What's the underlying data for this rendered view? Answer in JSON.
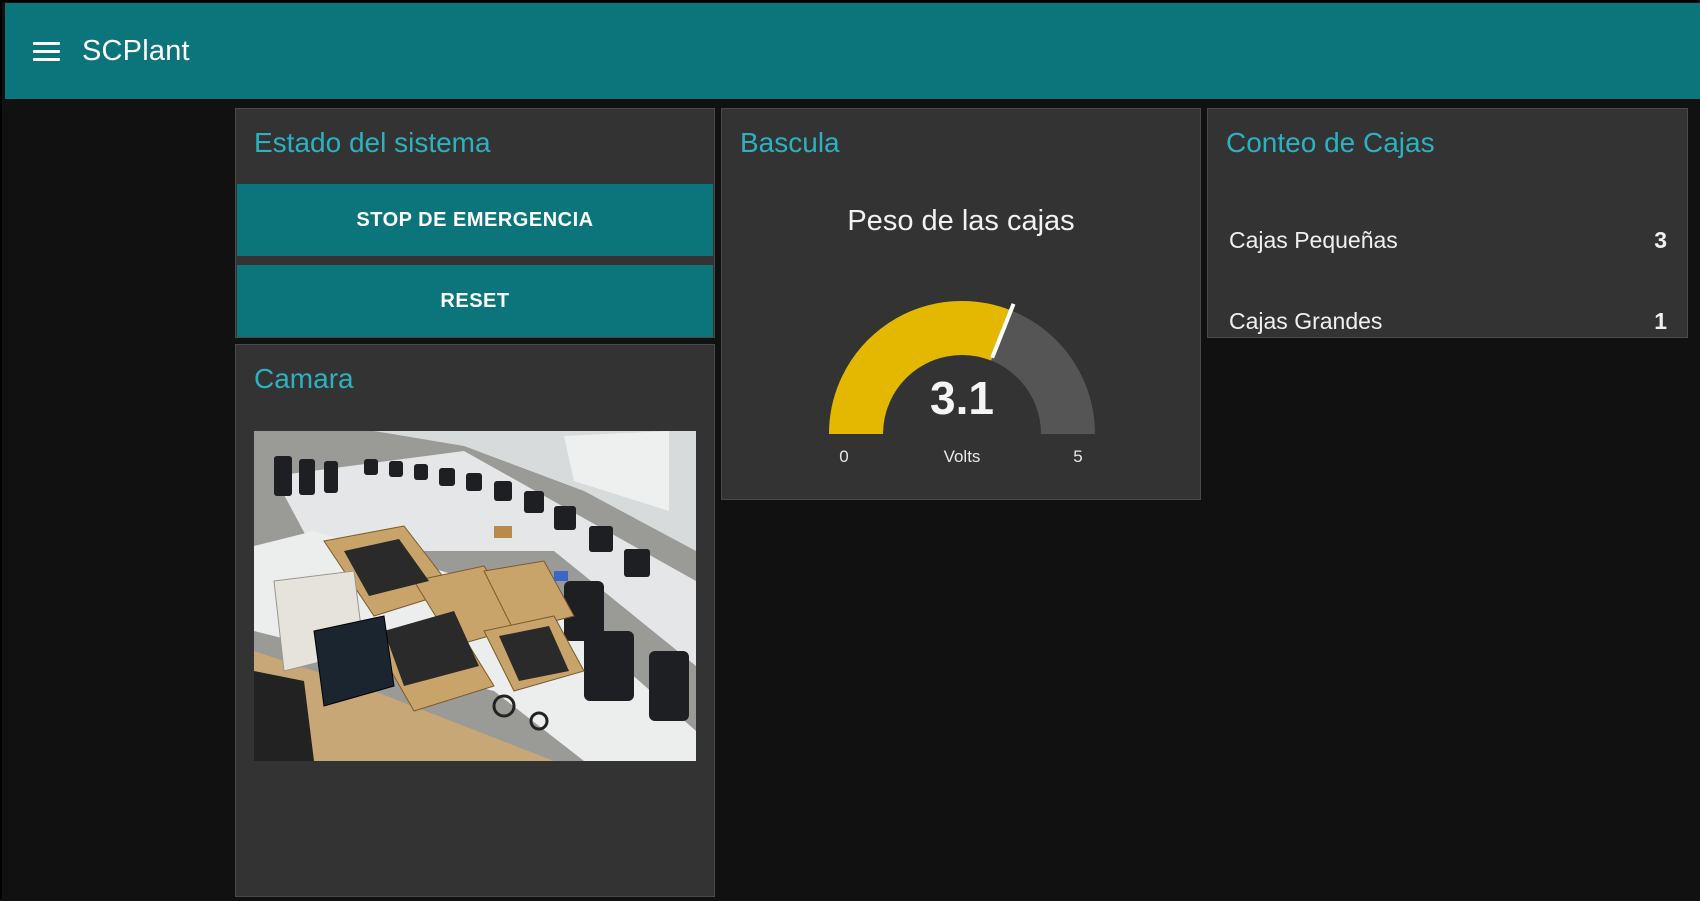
{
  "header": {
    "title": "SCPlant"
  },
  "estado": {
    "title": "Estado del sistema",
    "stop_label": "STOP DE EMERGENCIA",
    "reset_label": "RESET"
  },
  "camara": {
    "title": "Camara"
  },
  "bascula": {
    "title": "Bascula",
    "gauge": {
      "label": "Peso de las cajas",
      "value": 3.1,
      "value_text": "3.1",
      "min": 0,
      "max": 5,
      "min_text": "0",
      "max_text": "5",
      "units": "Volts",
      "fill_color": "#e5b800",
      "track_color": "#555555"
    }
  },
  "conteo": {
    "title": "Conteo de Cajas",
    "rows": [
      {
        "label": "Cajas Pequeñas",
        "value": "3"
      },
      {
        "label": "Cajas Grandes",
        "value": "1"
      }
    ]
  },
  "colors": {
    "accent": "#0b757b",
    "title": "#2bb2c0",
    "card": "#333333",
    "background": "#111111"
  }
}
